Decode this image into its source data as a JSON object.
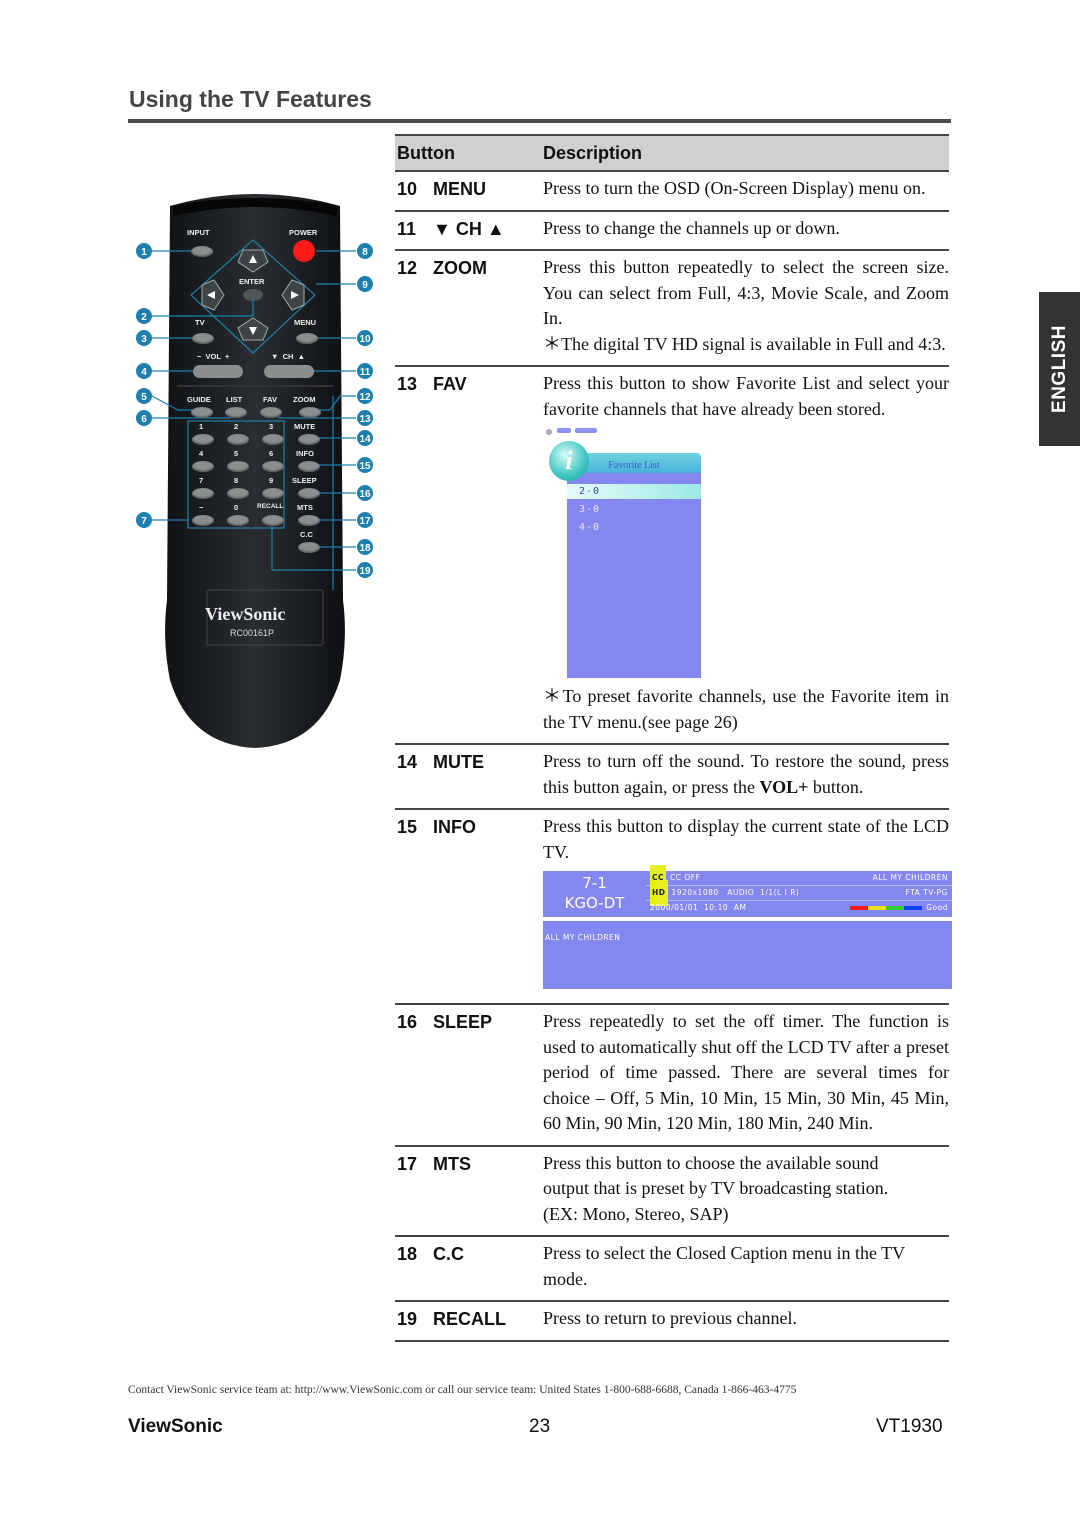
{
  "page": {
    "title": "Using the TV Features",
    "language_tab": "ENGLISH"
  },
  "remote": {
    "labels": {
      "input": "INPUT",
      "power": "POWER",
      "enter": "ENTER",
      "tv": "TV",
      "menu": "MENU",
      "vol": "−  VOL  +",
      "ch": "▼  CH  ▲",
      "guide": "GUIDE",
      "list": "LIST",
      "fav": "FAV",
      "zoom": "ZOOM",
      "k1": "1",
      "k2": "2",
      "k3": "3",
      "k4": "4",
      "k5": "5",
      "k6": "6",
      "k7": "7",
      "k8": "8",
      "k9": "9",
      "kdash": "−",
      "k0": "0",
      "mute": "MUTE",
      "info": "INFO",
      "sleep": "SLEEP",
      "recall": "RECALL",
      "mts": "MTS",
      "cc": "C.C"
    },
    "brand": "ViewSonic",
    "model": "RC00161P",
    "callouts": [
      "1",
      "2",
      "3",
      "4",
      "5",
      "6",
      "7",
      "8",
      "9",
      "10",
      "11",
      "12",
      "13",
      "14",
      "15",
      "16",
      "17",
      "18",
      "19"
    ],
    "colors": {
      "body": "#1c1f21",
      "button": "#8a8e8f",
      "power": "#ff1a1a",
      "callout": "#1f7fae"
    }
  },
  "table": {
    "header": {
      "button": "Button",
      "description": "Description"
    },
    "rows": [
      {
        "num": "10",
        "name": "MENU",
        "desc": "Press to turn the OSD (On-Screen Display) menu on."
      },
      {
        "num": "11",
        "name": "▼ CH ▲",
        "desc": "Press to change the channels up or down."
      },
      {
        "num": "12",
        "name": "ZOOM",
        "desc": "Press this button repeatedly to select the screen size. You can select from Full, 4:3, Movie Scale, and Zoom In.",
        "note": "＊The digital TV HD signal is available in Full and 4:3."
      },
      {
        "num": "13",
        "name": "FAV",
        "desc": "Press this button to show Favorite List and select your favorite channels that have already been stored.",
        "note": "＊To preset favorite channels, use the Favorite item in the TV menu.(see page 26)"
      },
      {
        "num": "14",
        "name": "MUTE",
        "desc_pre": "Press to turn off the sound. To restore the sound, press this button again, or press the ",
        "desc_bold": "VOL+",
        "desc_post": " button."
      },
      {
        "num": "15",
        "name": "INFO",
        "desc": "Press this button to display the current state of the LCD TV."
      },
      {
        "num": "16",
        "name": "SLEEP",
        "desc": "Press repeatedly to set the off timer. The function is used to automatically shut off the LCD TV after a preset period of time passed. There are several times for choice – Off, 5 Min, 10 Min, 15 Min, 30 Min, 45 Min, 60 Min, 90 Min, 120 Min, 180 Min, 240 Min."
      },
      {
        "num": "17",
        "name": "MTS",
        "desc": "Press this button to choose the available sound output that is preset by TV broadcasting station. (EX: Mono, Stereo, SAP)"
      },
      {
        "num": "18",
        "name": "C.C",
        "desc": "Press to select the Closed Caption menu in the TV mode."
      },
      {
        "num": "19",
        "name": "RECALL",
        "desc": "Press to return to previous channel."
      }
    ]
  },
  "favorite_osd": {
    "icon": "i",
    "header": "Favorite List",
    "items": [
      "2-0",
      "3-0",
      "4-0"
    ],
    "selected_index": 0
  },
  "info_osd": {
    "channel": "7-1",
    "station": "KGO-DT",
    "cc_tag": "CC",
    "cc_status": "CC OFF",
    "program": "ALL MY CHILDREN",
    "hd_tag": "HD",
    "resolution_audio": "1920x1080   AUDIO  1/1(L I R)",
    "rating": "FTA TV-PG",
    "datetime": "2000/01/01  10:10  AM",
    "signal_label": "Good",
    "signal_colors": [
      "#ff1a1a",
      "#e8e020",
      "#30d030",
      "#1040f0"
    ],
    "description": "ALL MY CHILDREN"
  },
  "footer": {
    "contact": "Contact ViewSonic service team at: http://www.ViewSonic.com or call our service team: United States 1-800-688-6688, Canada 1-866-463-4775",
    "brand": "ViewSonic",
    "page_number": "23",
    "model": "VT1930"
  }
}
